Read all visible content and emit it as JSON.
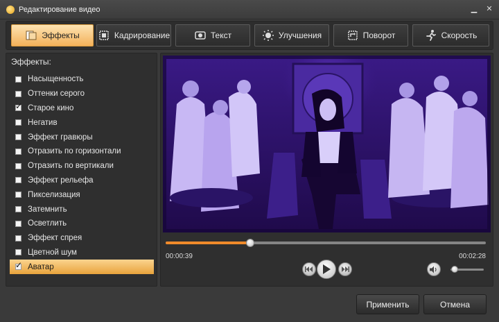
{
  "window": {
    "title": "Редактирование видео"
  },
  "tabs": [
    {
      "label": "Эффекты",
      "icon": "effects-icon",
      "active": true
    },
    {
      "label": "Кадрирование",
      "icon": "crop-icon",
      "active": false
    },
    {
      "label": "Текст",
      "icon": "text-icon",
      "active": false
    },
    {
      "label": "Улучшения",
      "icon": "enhance-icon",
      "active": false
    },
    {
      "label": "Поворот",
      "icon": "rotate-icon",
      "active": false
    },
    {
      "label": "Скорость",
      "icon": "speed-icon",
      "active": false
    }
  ],
  "effects": {
    "header": "Эффекты:",
    "items": [
      {
        "label": "Насыщенность",
        "checked": false,
        "selected": false
      },
      {
        "label": "Оттенки серого",
        "checked": false,
        "selected": false
      },
      {
        "label": "Старое кино",
        "checked": true,
        "selected": false
      },
      {
        "label": "Негатив",
        "checked": false,
        "selected": false
      },
      {
        "label": "Эффект гравюры",
        "checked": false,
        "selected": false
      },
      {
        "label": "Отразить по горизонтали",
        "checked": false,
        "selected": false
      },
      {
        "label": "Отразить по вертикали",
        "checked": false,
        "selected": false
      },
      {
        "label": "Эффект рельефа",
        "checked": false,
        "selected": false
      },
      {
        "label": "Пикселизация",
        "checked": false,
        "selected": false
      },
      {
        "label": "Затемнить",
        "checked": false,
        "selected": false
      },
      {
        "label": "Осветлить",
        "checked": false,
        "selected": false
      },
      {
        "label": "Эффект спрея",
        "checked": false,
        "selected": false
      },
      {
        "label": "Цветной шум",
        "checked": false,
        "selected": false
      },
      {
        "label": "Аватар",
        "checked": true,
        "selected": true
      }
    ]
  },
  "player": {
    "current_time": "00:00:39",
    "total_time": "00:02:28",
    "progress": 0.265,
    "volume": 0.12
  },
  "buttons": {
    "apply": "Применить",
    "cancel": "Отмена"
  },
  "colors": {
    "accent": "#f3b15a",
    "progress": "#f08a2a",
    "video_tint": "#5a2fc0"
  }
}
